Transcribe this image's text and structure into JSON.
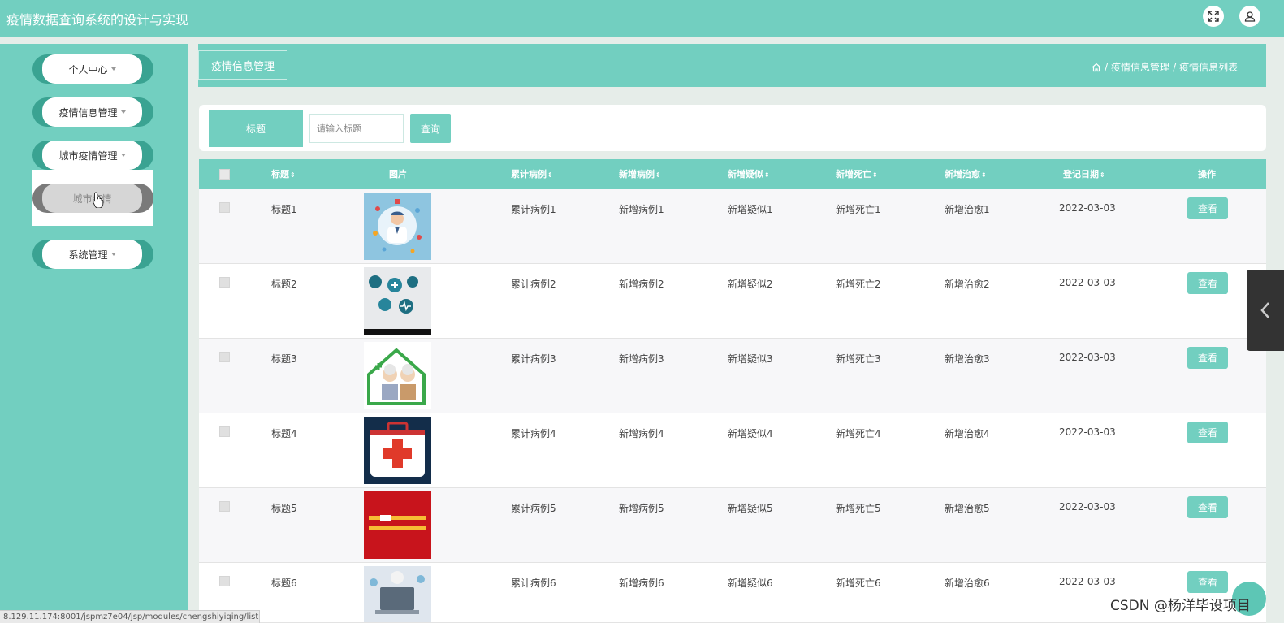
{
  "app": {
    "title": "疫情数据查询系统的设计与实现"
  },
  "topbar": {
    "fullscreen_icon": "fullscreen-icon",
    "user_icon": "user-icon"
  },
  "sidebar": {
    "items": [
      {
        "label": "个人中心"
      },
      {
        "label": "疫情信息管理"
      },
      {
        "label": "城市疫情管理"
      },
      {
        "label": "系统管理"
      }
    ],
    "submenu": [
      {
        "label": "城市疫情"
      }
    ]
  },
  "header": {
    "title": "疫情信息管理",
    "breadcrumb": [
      "疫情信息管理",
      "疫情信息列表"
    ]
  },
  "search": {
    "label": "标题",
    "placeholder": "请输入标题",
    "button": "查询"
  },
  "table": {
    "columns": [
      "标题",
      "图片",
      "累计病例",
      "新增病例",
      "新增疑似",
      "新增死亡",
      "新增治愈",
      "登记日期",
      "操作"
    ],
    "rows": [
      {
        "title": "标题1",
        "total": "累计病例1",
        "new_cases": "新增病例1",
        "suspected": "新增疑似1",
        "deaths": "新增死亡1",
        "cured": "新增治愈1",
        "date": "2022-03-03",
        "action": "查看"
      },
      {
        "title": "标题2",
        "total": "累计病例2",
        "new_cases": "新增病例2",
        "suspected": "新增疑似2",
        "deaths": "新增死亡2",
        "cured": "新增治愈2",
        "date": "2022-03-03",
        "action": "查看"
      },
      {
        "title": "标题3",
        "total": "累计病例3",
        "new_cases": "新增病例3",
        "suspected": "新增疑似3",
        "deaths": "新增死亡3",
        "cured": "新增治愈3",
        "date": "2022-03-03",
        "action": "查看"
      },
      {
        "title": "标题4",
        "total": "累计病例4",
        "new_cases": "新增病例4",
        "suspected": "新增疑似4",
        "deaths": "新增死亡4",
        "cured": "新增治愈4",
        "date": "2022-03-03",
        "action": "查看"
      },
      {
        "title": "标题5",
        "total": "累计病例5",
        "new_cases": "新增病例5",
        "suspected": "新增疑似5",
        "deaths": "新增死亡5",
        "cured": "新增治愈5",
        "date": "2022-03-03",
        "action": "查看"
      },
      {
        "title": "标题6",
        "total": "累计病例6",
        "new_cases": "新增病例6",
        "suspected": "新增疑似6",
        "deaths": "新增死亡6",
        "cured": "新增治愈6",
        "date": "2022-03-03",
        "action": "查看"
      }
    ]
  },
  "status_url": "8.129.11.174:8001/jspmz7e04/jsp/modules/chengshiyiqing/list.jsp",
  "watermark": "CSDN @杨洋毕设项目",
  "colors": {
    "accent": "#72cfc0",
    "accent_dark": "#3aa392"
  }
}
